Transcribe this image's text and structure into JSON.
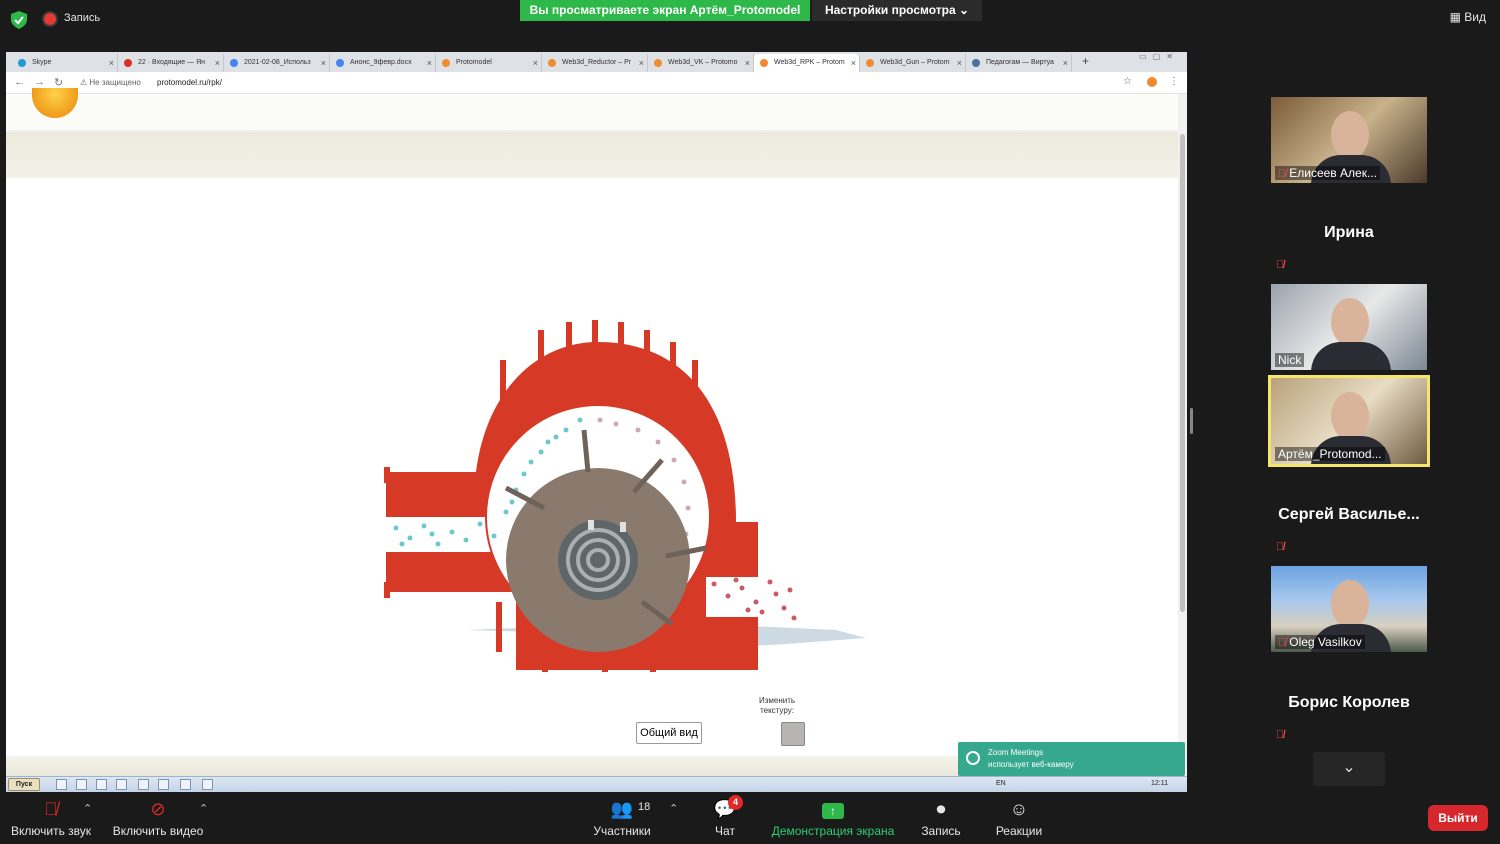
{
  "zoom": {
    "recording_label": "Запись",
    "share_banner": "Вы просматриваете экран Артём_Protomodel",
    "view_settings": "Настройки просмотра ⌄",
    "view_button": "Вид",
    "leave_button": "Выйти"
  },
  "browser": {
    "tabs": [
      {
        "label": "Skype",
        "color": "#1d9bd7"
      },
      {
        "label": "22 · Входящие — Ян",
        "color": "#d93025"
      },
      {
        "label": "2021-02-08_Использ",
        "color": "#4285f4"
      },
      {
        "label": "Анонс_9февр.docx",
        "color": "#4285f4"
      },
      {
        "label": "Protomodel",
        "color": "#f28b30"
      },
      {
        "label": "Web3d_Reductor – Pr",
        "color": "#f28b30"
      },
      {
        "label": "Web3d_VK – Protomo",
        "color": "#f28b30"
      },
      {
        "label": "Web3d_RPK – Protom",
        "color": "#f28b30",
        "active": true
      },
      {
        "label": "Web3d_Gun – Protom",
        "color": "#f28b30"
      },
      {
        "label": "Педагогам — Виртуа",
        "color": "#4a6fa5"
      }
    ],
    "not_secure": "Не защищено",
    "url": "protomodel.ru/rpk/"
  },
  "page": {
    "general_view_button": "Общий вид",
    "change_texture_label": "Изменить текстуру:",
    "texture_color": "#b9b4b4"
  },
  "taskbar": {
    "start_label": "Пуск",
    "lang": "EN",
    "clock": "12:11"
  },
  "toast": {
    "title": "Zoom Meetings",
    "subtitle": "использует веб-камеру"
  },
  "participants": [
    {
      "name": "Елисеев Алек...",
      "type": "video",
      "muted": true
    },
    {
      "name": "Ирина",
      "type": "name",
      "muted": true
    },
    {
      "name": "Nick",
      "type": "video",
      "muted": false
    },
    {
      "name": "Артём_Protomod...",
      "type": "video",
      "muted": false,
      "speaking": true
    },
    {
      "name": "Сергей  Василье...",
      "type": "name",
      "muted": true
    },
    {
      "name": "Oleg Vasilkov",
      "type": "video",
      "muted": true
    },
    {
      "name": "Борис Королев",
      "type": "name",
      "muted": true
    }
  ],
  "toolbar": {
    "unmute": "Включить звук",
    "start_video": "Включить видео",
    "participants": "Участники",
    "participants_count": "18",
    "chat": "Чат",
    "chat_badge": "4",
    "share_screen": "Демонстрация экрана",
    "record": "Запись",
    "reactions": "Реакции"
  }
}
